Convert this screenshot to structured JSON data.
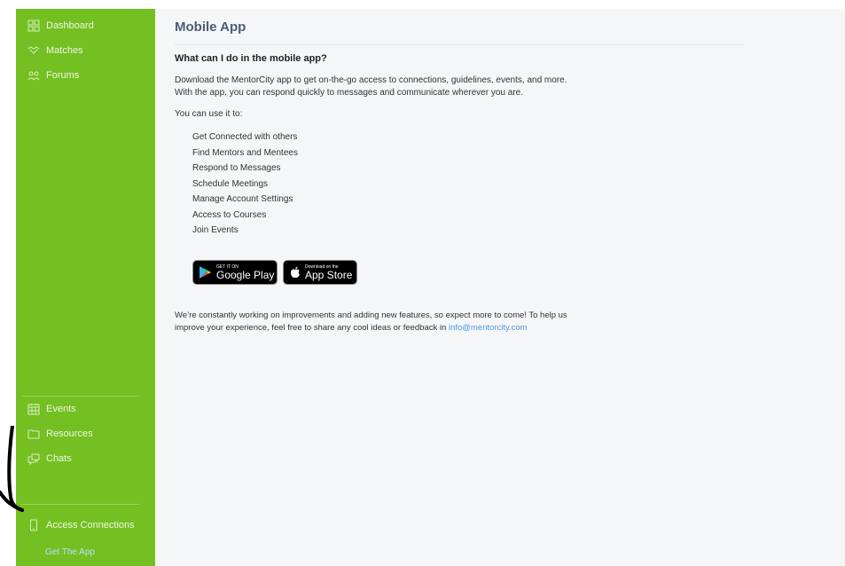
{
  "colors": {
    "sidebar": "#74bf22",
    "main_bg": "#f5f6f8",
    "title": "#4a5d78",
    "link": "#4a9be0",
    "get_app": "#b9e0ff"
  },
  "sidebar": {
    "top_items": [
      {
        "label": "Dashboard",
        "icon": "dashboard-icon"
      },
      {
        "label": "Matches",
        "icon": "handshake-icon"
      },
      {
        "label": "Forums",
        "icon": "people-icon"
      }
    ],
    "bottom_items": [
      {
        "label": "Events",
        "icon": "calendar-icon"
      },
      {
        "label": "Resources",
        "icon": "folder-icon"
      },
      {
        "label": "Chats",
        "icon": "chat-icon"
      }
    ],
    "access_connections": {
      "label": "Access Connections",
      "icon": "phone-icon"
    },
    "get_app": "Get The App"
  },
  "main": {
    "title": "Mobile App",
    "heading": "What can I do in the mobile app?",
    "intro_line1": "Download the MentorCity app to get on-the-go access to connections, guidelines, events, and more.",
    "intro_line2": "With the app, you can respond quickly to messages and communicate wherever you are.",
    "use_label": "You can use it to:",
    "features": [
      "Get Connected with others",
      "Find Mentors and Mentees",
      "Respond to Messages",
      "Schedule Meetings",
      "Manage Account Settings",
      "Access to Courses",
      "Join Events"
    ],
    "google_play": {
      "small": "GET IT ON",
      "big": "Google Play"
    },
    "app_store": {
      "small": "Download on the",
      "big": "App Store"
    },
    "footer_line1": "We’re constantly working on improvements and adding new features, so expect more to come! To help us",
    "footer_line2_prefix": "improve your experience, feel free to share any cool ideas or feedback in ",
    "email": "info@mentorcity.com"
  }
}
